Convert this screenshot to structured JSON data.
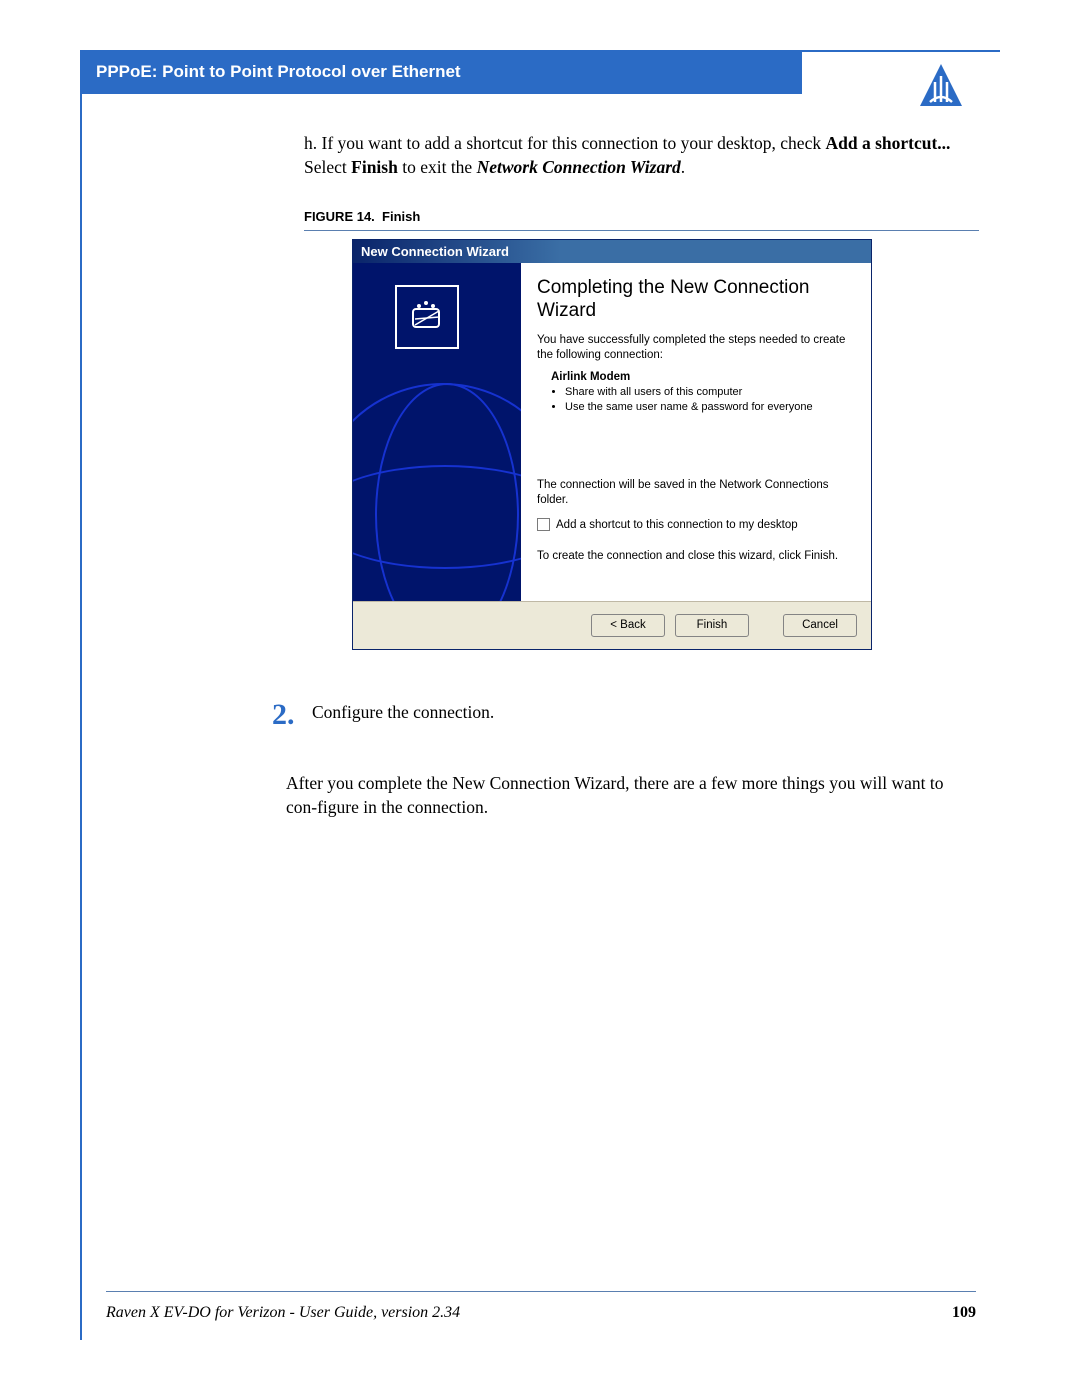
{
  "header": {
    "title": "PPPoE: Point to Point Protocol over Ethernet"
  },
  "body": {
    "intro_h": " h. If you want to add a shortcut for this connection to your desktop, check ",
    "intro_bold_1": "Add a shortcut...",
    "intro_select": "Select ",
    "intro_finish": "Finish",
    "intro_to_exit": " to exit the ",
    "intro_wizard": "Network Connection Wizard",
    "intro_period": "."
  },
  "figure": {
    "label": "FIGURE 14.",
    "title": "Finish"
  },
  "wizard": {
    "titlebar": "New Connection Wizard",
    "heading": "Completing the New Connection Wizard",
    "text1": "You have successfully completed the steps needed to create the following connection:",
    "conn_name": "Airlink Modem",
    "bullet1": "Share with all users of this computer",
    "bullet2": "Use the same user name & password for everyone",
    "text2": "The connection will be saved in the Network Connections folder.",
    "checkbox_label": "Add a shortcut to this connection to my desktop",
    "text3": "To create the connection and close this wizard, click Finish.",
    "btn_back": "< Back",
    "btn_finish": "Finish",
    "btn_cancel": "Cancel"
  },
  "step": {
    "num": "2.",
    "text": "Configure the connection."
  },
  "after_text": "After you complete the New Connection Wizard, there are a few more things you will want to con-figure in the connection.",
  "footer": {
    "left": "Raven X EV-DO for Verizon - User Guide, version 2.34",
    "page": "109"
  }
}
